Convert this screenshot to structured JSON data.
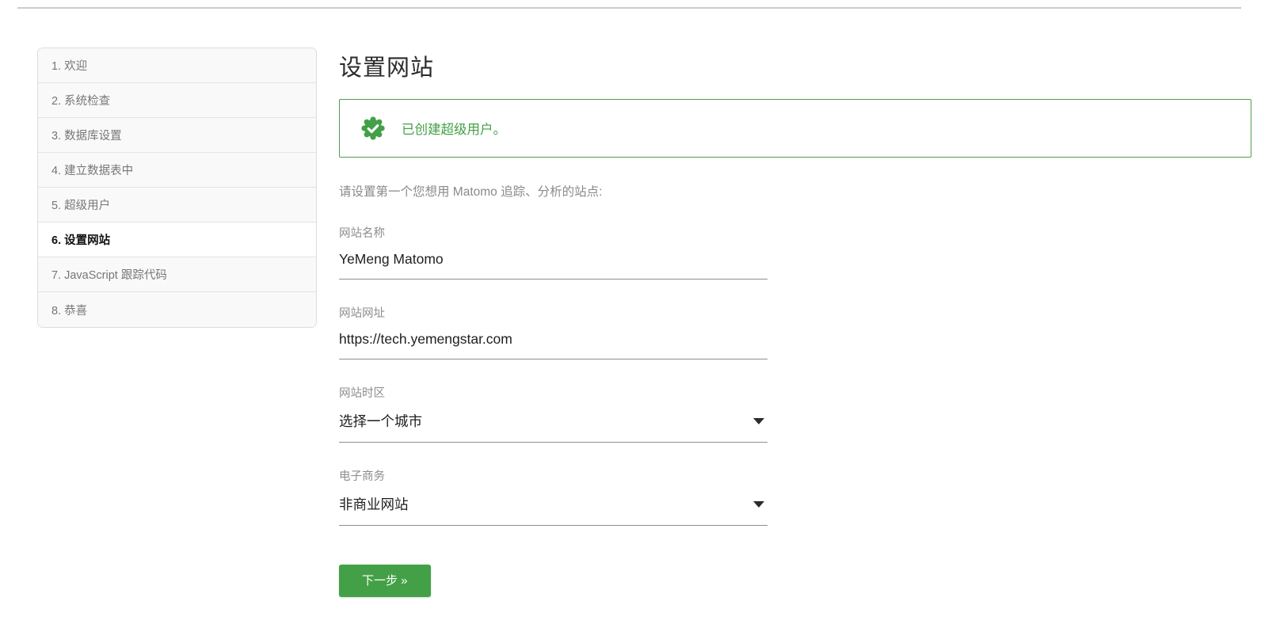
{
  "colors": {
    "accent_green": "#43a047",
    "success_border": "#4c9f50",
    "sidebar_bg": "#f9f9f9",
    "label_gray": "#8d8d8d"
  },
  "sidebar": {
    "items": [
      {
        "label": "1. 欢迎",
        "active": false
      },
      {
        "label": "2. 系统检查",
        "active": false
      },
      {
        "label": "3. 数据库设置",
        "active": false
      },
      {
        "label": "4. 建立数据表中",
        "active": false
      },
      {
        "label": "5. 超级用户",
        "active": false
      },
      {
        "label": "6. 设置网站",
        "active": true
      },
      {
        "label": "7. JavaScript 跟踪代码",
        "active": false
      },
      {
        "label": "8. 恭喜",
        "active": false
      }
    ]
  },
  "main": {
    "title": "设置网站",
    "success_message": "已创建超级用户。",
    "success_icon": "check-seal-icon",
    "description": "请设置第一个您想用 Matomo 追踪、分析的站点:",
    "fields": [
      {
        "label": "网站名称",
        "value": "YeMeng Matomo",
        "type": "text"
      },
      {
        "label": "网站网址",
        "value": "https://tech.yemengstar.com",
        "type": "text"
      },
      {
        "label": "网站时区",
        "value": "选择一个城市",
        "type": "select"
      },
      {
        "label": "电子商务",
        "value": "非商业网站",
        "type": "select"
      }
    ],
    "next_button_label": "下一步 »"
  }
}
